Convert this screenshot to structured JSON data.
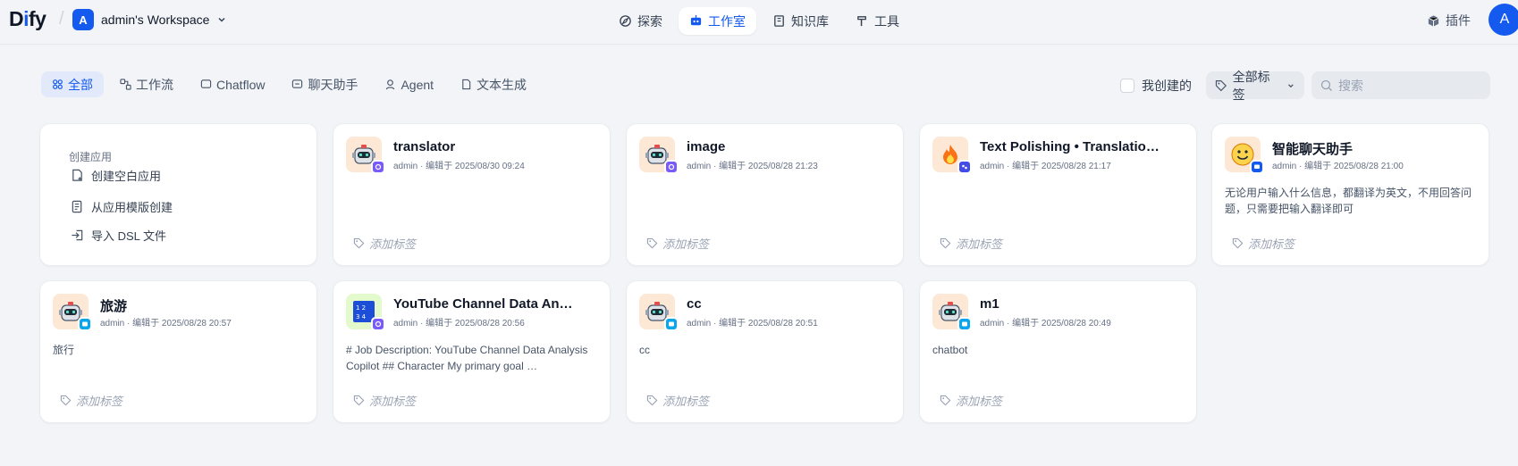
{
  "header": {
    "logo": {
      "part1": "D",
      "part2": "i",
      "part3": "fy"
    },
    "workspace": {
      "avatar": "A",
      "name": "admin's Workspace"
    },
    "nav": [
      {
        "label": "探索",
        "icon": "compass-icon"
      },
      {
        "label": "工作室",
        "icon": "robot-icon",
        "active": true
      },
      {
        "label": "知识库",
        "icon": "book-icon"
      },
      {
        "label": "工具",
        "icon": "hammer-icon"
      }
    ],
    "plugin_label": "插件",
    "user_avatar": "A"
  },
  "filters": {
    "tabs": [
      {
        "label": "全部",
        "active": true
      },
      {
        "label": "工作流"
      },
      {
        "label": "Chatflow"
      },
      {
        "label": "聊天助手"
      },
      {
        "label": "Agent"
      },
      {
        "label": "文本生成"
      }
    ],
    "mine_label": "我创建的",
    "tag_select": "全部标签",
    "search_placeholder": "搜索"
  },
  "create_card": {
    "title": "创建应用",
    "items": [
      "创建空白应用",
      "从应用模版创建",
      "导入 DSL 文件"
    ]
  },
  "add_tag_label": "添加标签",
  "apps": [
    {
      "name": "translator",
      "meta": "admin · 编辑于 2025/08/30 09:24",
      "desc": "",
      "icon": "robot-icon",
      "icon_bg": "#fde8d5",
      "badge": "workflow",
      "badge_color": "#7a5af8"
    },
    {
      "name": "image",
      "meta": "admin · 编辑于 2025/08/28 21:23",
      "desc": "",
      "icon": "robot-icon",
      "icon_bg": "#fde8d5",
      "badge": "workflow",
      "badge_color": "#7a5af8"
    },
    {
      "name": "Text Polishing • Translatio…",
      "meta": "admin · 编辑于 2025/08/28 21:17",
      "desc": "",
      "icon": "fire-icon",
      "icon_bg": "#fde8d5",
      "badge": "agent",
      "badge_color": "#444ce7"
    },
    {
      "name": "智能聊天助手",
      "meta": "admin · 编辑于 2025/08/28 21:00",
      "desc": "无论用户输入什么信息，都翻译为英文，不用回答问题，只需要把输入翻译即可",
      "icon": "smile-icon",
      "icon_bg": "#fde8d5",
      "badge": "chat",
      "badge_color": "#155aef"
    },
    {
      "name": "旅游",
      "meta": "admin · 编辑于 2025/08/28 20:57",
      "desc": "旅行",
      "icon": "robot-icon",
      "icon_bg": "#fde8d5",
      "badge": "chatbot",
      "badge_color": "#0ba5ec"
    },
    {
      "name": "YouTube Channel Data An…",
      "meta": "admin · 编辑于 2025/08/28 20:56",
      "desc": "# Job Description: YouTube Channel Data Analysis Copilot ## Character My primary goal …",
      "icon": "numbers-icon",
      "icon_bg": "#e3fbcc",
      "badge": "workflow",
      "badge_color": "#7a5af8"
    },
    {
      "name": "cc",
      "meta": "admin · 编辑于 2025/08/28 20:51",
      "desc": "cc",
      "icon": "robot-icon",
      "icon_bg": "#fde8d5",
      "badge": "chatbot",
      "badge_color": "#0ba5ec"
    },
    {
      "name": "m1",
      "meta": "admin · 编辑于 2025/08/28 20:49",
      "desc": "chatbot",
      "icon": "robot-icon",
      "icon_bg": "#fde8d5",
      "badge": "chatbot",
      "badge_color": "#0ba5ec"
    }
  ]
}
